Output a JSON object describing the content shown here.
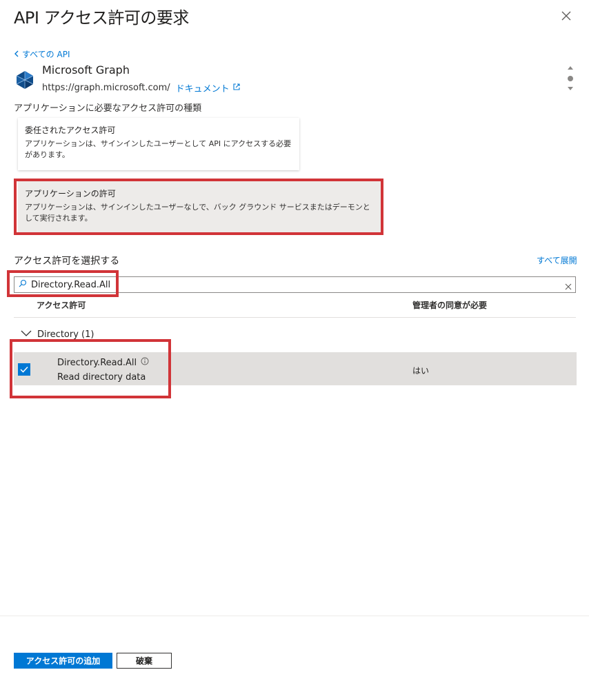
{
  "panel": {
    "title": "API アクセス許可の要求",
    "back_link": "すべての API"
  },
  "api": {
    "name": "Microsoft Graph",
    "url": "https://graph.microsoft.com/",
    "doc_link": "ドキュメント"
  },
  "permission_type": {
    "label": "アプリケーションに必要なアクセス許可の種類",
    "options": [
      {
        "title": "委任されたアクセス許可",
        "description": "アプリケーションは、サインインしたユーザーとして API にアクセスする必要があります。",
        "selected": false
      },
      {
        "title": "アプリケーションの許可",
        "description": "アプリケーションは、サインインしたユーザーなしで、バック グラウンド サービスまたはデーモンとして実行されます。",
        "selected": true
      }
    ]
  },
  "select": {
    "label": "アクセス許可を選択する",
    "expand_all": "すべて展開",
    "search_value": "Directory.Read.All"
  },
  "table": {
    "columns": [
      "アクセス許可",
      "管理者の同意が必要"
    ],
    "group": {
      "label": "Directory (1)",
      "expanded": true
    },
    "rows": [
      {
        "name": "Directory.Read.All",
        "description": "Read directory data",
        "admin_consent": "はい",
        "checked": true
      }
    ]
  },
  "footer": {
    "add_button": "アクセス許可の追加",
    "discard_button": "破棄"
  },
  "colors": {
    "accent": "#0078d4",
    "highlight": "#d13438"
  }
}
